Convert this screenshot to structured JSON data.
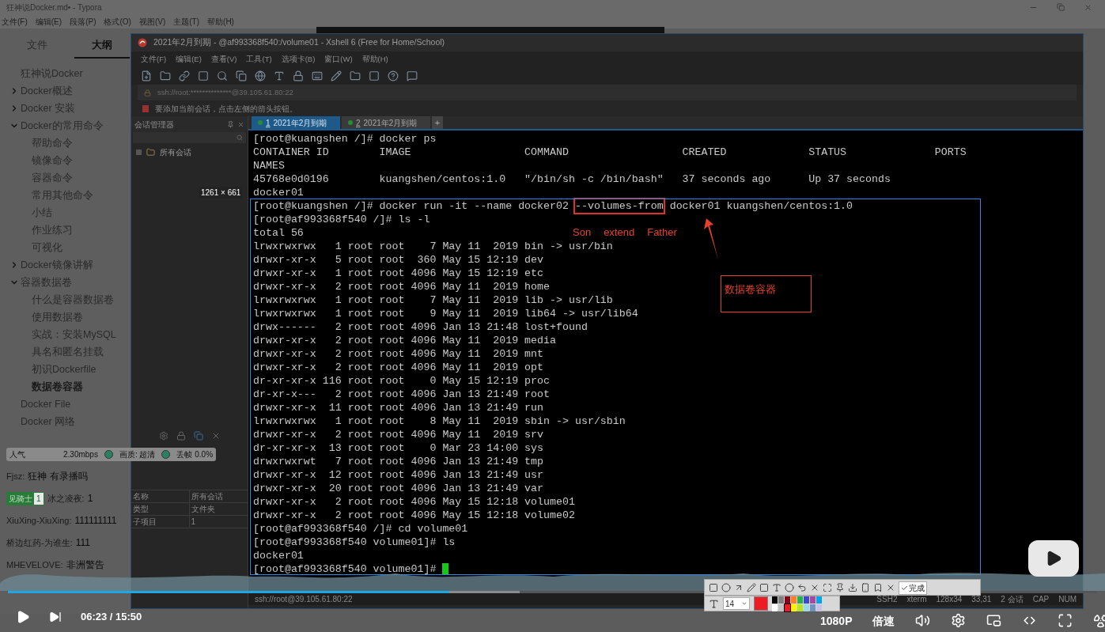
{
  "typora": {
    "title": "狂神说Docker.md• - Typora",
    "menu": [
      "文件(F)",
      "编辑(E)",
      "段落(P)",
      "格式(O)",
      "视图(V)",
      "主题(T)",
      "帮助(H)"
    ],
    "tabs": [
      {
        "label": "文件",
        "selected": false
      },
      {
        "label": "大纲",
        "selected": true
      }
    ],
    "outline": [
      {
        "label": "狂神说Docker",
        "selected": false
      },
      {
        "label": "Docker概述",
        "selected": false,
        "expanded": false
      },
      {
        "label": "Docker 安装",
        "selected": false,
        "expanded": false
      },
      {
        "label": "Docker的常用命令",
        "selected": false,
        "expanded": true,
        "children": [
          {
            "label": "帮助命令",
            "selected": false
          },
          {
            "label": "镜像命令",
            "selected": false
          },
          {
            "label": "容器命令",
            "selected": false
          },
          {
            "label": "常用其他命令",
            "selected": false
          },
          {
            "label": "小结",
            "selected": false
          },
          {
            "label": "作业练习",
            "selected": false
          },
          {
            "label": "可视化",
            "selected": false
          }
        ]
      },
      {
        "label": "Docker镜像讲解",
        "selected": false,
        "expanded": false
      },
      {
        "label": "容器数据卷",
        "selected": false,
        "expanded": true,
        "children": [
          {
            "label": "什么是容器数据卷",
            "selected": false
          },
          {
            "label": "使用数据卷",
            "selected": false
          },
          {
            "label": "实战：安装MySQL",
            "selected": false
          },
          {
            "label": "具名和匿名挂载",
            "selected": false
          },
          {
            "label": "初识Dockerfile",
            "selected": false
          },
          {
            "label": "数据卷容器",
            "selected": true
          }
        ]
      },
      {
        "label": "Docker File",
        "selected": false
      },
      {
        "label": "Docker 网络",
        "selected": false
      }
    ]
  },
  "xshell": {
    "title": "2021年2月到期 - @af993368f540:/volume01 - Xshell 6 (Free for Home/School)",
    "menu": [
      "文件(F)",
      "编辑(E)",
      "查看(V)",
      "工具(T)",
      "选项卡(B)",
      "窗口(W)",
      "帮助(H)"
    ],
    "address": "ssh://root:**************@39.105.61.80:22",
    "hint": "要添加当前会话，点击左侧的箭头按钮。",
    "session_panel": {
      "title": "会话管理器",
      "tree": [
        {
          "label": "所有会话"
        }
      ],
      "properties": [
        {
          "name": "名称",
          "value": "所有会话"
        },
        {
          "name": "类型",
          "value": "文件夹"
        },
        {
          "name": "子项目",
          "value": "1"
        }
      ]
    },
    "tabs": [
      {
        "number": "1",
        "label": "2021年2月到期",
        "selected": true
      },
      {
        "number": "2",
        "label": "2021年2月到期",
        "selected": false
      }
    ],
    "new_tab": "+",
    "terminal": [
      {
        "text": "[root@kuangshen /]# docker ps"
      },
      {
        "text": "CONTAINER ID        IMAGE                  COMMAND                  CREATED             STATUS              PORTS"
      },
      {
        "text": "NAMES"
      },
      {
        "text": "45768e0d0196        kuangshen/centos:1.0   \"/bin/sh -c /bin/bash\"   37 seconds ago      Up 37 seconds"
      },
      {
        "text": "docker01"
      },
      {
        "segments": [
          {
            "text": "[root@kuangshen /]# docker run -it --name docker02 ",
            "boxed": false
          },
          {
            "text": "--volumes-from",
            "boxed": true
          },
          {
            "text": " docker01 kuangshen/centos:1.0",
            "boxed": false
          }
        ]
      },
      {
        "text": "[root@af993368f540 /]# ls -l"
      },
      {
        "text": "total 56"
      },
      {
        "text": "lrwxrwxrwx   1 root root    7 May 11  2019 bin -> usr/bin"
      },
      {
        "text": "drwxr-xr-x   5 root root  360 May 15 12:19 dev"
      },
      {
        "text": "drwxr-xr-x   1 root root 4096 May 15 12:19 etc"
      },
      {
        "text": "drwxr-xr-x   2 root root 4096 May 11  2019 home"
      },
      {
        "text": "lrwxrwxrwx   1 root root    7 May 11  2019 lib -> usr/lib"
      },
      {
        "text": "lrwxrwxrwx   1 root root    9 May 11  2019 lib64 -> usr/lib64"
      },
      {
        "text": "drwx------   2 root root 4096 Jan 13 21:48 lost+found"
      },
      {
        "text": "drwxr-xr-x   2 root root 4096 May 11  2019 media"
      },
      {
        "text": "drwxr-xr-x   2 root root 4096 May 11  2019 mnt"
      },
      {
        "text": "drwxr-xr-x   2 root root 4096 May 11  2019 opt"
      },
      {
        "text": "dr-xr-xr-x 116 root root    0 May 15 12:19 proc"
      },
      {
        "text": "dr-xr-x---   2 root root 4096 Jan 13 21:49 root"
      },
      {
        "text": "drwxr-xr-x  11 root root 4096 Jan 13 21:49 run"
      },
      {
        "text": "lrwxrwxrwx   1 root root    8 May 11  2019 sbin -> usr/sbin"
      },
      {
        "text": "drwxr-xr-x   2 root root 4096 May 11  2019 srv"
      },
      {
        "text": "dr-xr-xr-x  13 root root    0 Mar 23 14:00 sys"
      },
      {
        "text": "drwxrwxrwt   7 root root 4096 Jan 13 21:49 tmp"
      },
      {
        "text": "drwxr-xr-x  12 root root 4096 Jan 13 21:49 usr"
      },
      {
        "text": "drwxr-xr-x  20 root root 4096 Jan 13 21:49 var"
      },
      {
        "text": "drwxr-xr-x   2 root root 4096 May 15 12:18 volume01"
      },
      {
        "text": "drwxr-xr-x   2 root root 4096 May 15 12:18 volume02"
      },
      {
        "text": "[root@af993368f540 /]# cd volume01"
      },
      {
        "text": "[root@af993368f540 volume01]# ls"
      },
      {
        "text": "docker01"
      },
      {
        "text": "[root@af993368f540 volume01]# ",
        "cursor": true
      }
    ],
    "status": {
      "address": "ssh://root@39.105.61.80:22",
      "items": [
        "SSH2",
        "xterm",
        "128x34",
        "33,31",
        "2 会话",
        "CAP",
        "NUM"
      ]
    }
  },
  "annotations": {
    "words": [
      "Son",
      "extend",
      "Father"
    ],
    "boxed_label": "数据卷容器",
    "selection_size": "1261 × 661"
  },
  "screenshot_toolbar": {
    "done": "完成",
    "font_size": "14",
    "colors": [
      {
        "color": "#000000",
        "selected": false
      },
      {
        "color": "#7f7f7f",
        "selected": false
      },
      {
        "color": "#880015",
        "selected": false
      },
      {
        "color": "#ff7f27",
        "selected": false
      },
      {
        "color": "#22b14c",
        "selected": false
      },
      {
        "color": "#3f48cc",
        "selected": false
      },
      {
        "color": "#a349a4",
        "selected": false
      },
      {
        "color": "#00a2e8",
        "selected": false
      },
      {
        "color": "#ffffff",
        "selected": false
      },
      {
        "color": "#c3c3c3",
        "selected": false
      },
      {
        "color": "#ed1c24",
        "selected": true
      },
      {
        "color": "#fff200",
        "selected": false
      },
      {
        "color": "#b5e61d",
        "selected": false
      },
      {
        "color": "#99d9ea",
        "selected": false
      },
      {
        "color": "#7092be",
        "selected": false
      },
      {
        "color": "#c8bfe7",
        "selected": false
      }
    ]
  },
  "danmaku": {
    "stats": {
      "label": "人气",
      "bitrate": "2.30mbps",
      "quality": "画质: 超清",
      "drop": "丢帧 0.0%"
    },
    "comments": [
      {
        "user": "Fjsz:",
        "text": "狂神 有录播吗"
      },
      {
        "badge": "见骑士",
        "badge_level": "1",
        "user": "冰之凌夜:",
        "text": "1"
      },
      {
        "user": "XiuXing-XiuXing:",
        "text": "111111111"
      },
      {
        "user": "桥边红药-为谁生:",
        "text": "111"
      },
      {
        "user": "MHEVELOVE:",
        "text": "非洲警告"
      }
    ]
  },
  "player": {
    "time": "06:23 / 15:50",
    "quality": "1080P",
    "speed": "倍速",
    "progress": {
      "level": 0.405
    },
    "buffer": {
      "level": 0.47
    }
  }
}
